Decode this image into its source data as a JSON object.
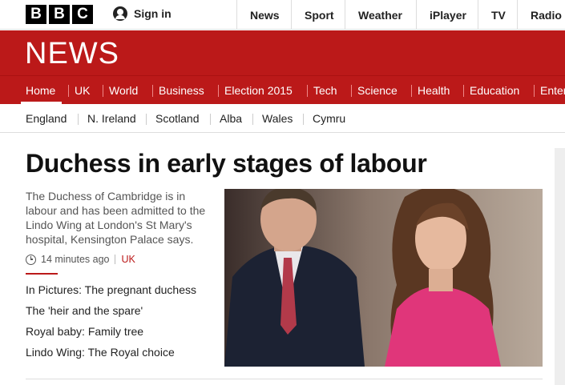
{
  "topbar": {
    "logo_letters": [
      "B",
      "B",
      "C"
    ],
    "signin_label": "Sign in",
    "signin_icon": "user-icon",
    "nav": [
      "News",
      "Sport",
      "Weather",
      "iPlayer",
      "TV",
      "Radio"
    ]
  },
  "banner": {
    "title": "NEWS",
    "color": "#bb1919"
  },
  "sections": {
    "items": [
      "Home",
      "UK",
      "World",
      "Business",
      "Election 2015",
      "Tech",
      "Science",
      "Health",
      "Education",
      "Enter"
    ],
    "active": "Home"
  },
  "subnav": {
    "items": [
      "England",
      "N. Ireland",
      "Scotland",
      "Alba",
      "Wales",
      "Cymru"
    ]
  },
  "story": {
    "headline": "Duchess in early stages of labour",
    "summary": "The Duchess of Cambridge is in labour and has been admitted to the Lindo Wing at London's St Mary's hospital, Kensington Palace says.",
    "time_icon": "clock-icon",
    "time": "14 minutes ago",
    "tag": "UK",
    "related": [
      "In Pictures: The pregnant duchess",
      "The 'heir and the spare'",
      "Royal baby: Family tree",
      "Lindo Wing: The Royal choice"
    ]
  }
}
